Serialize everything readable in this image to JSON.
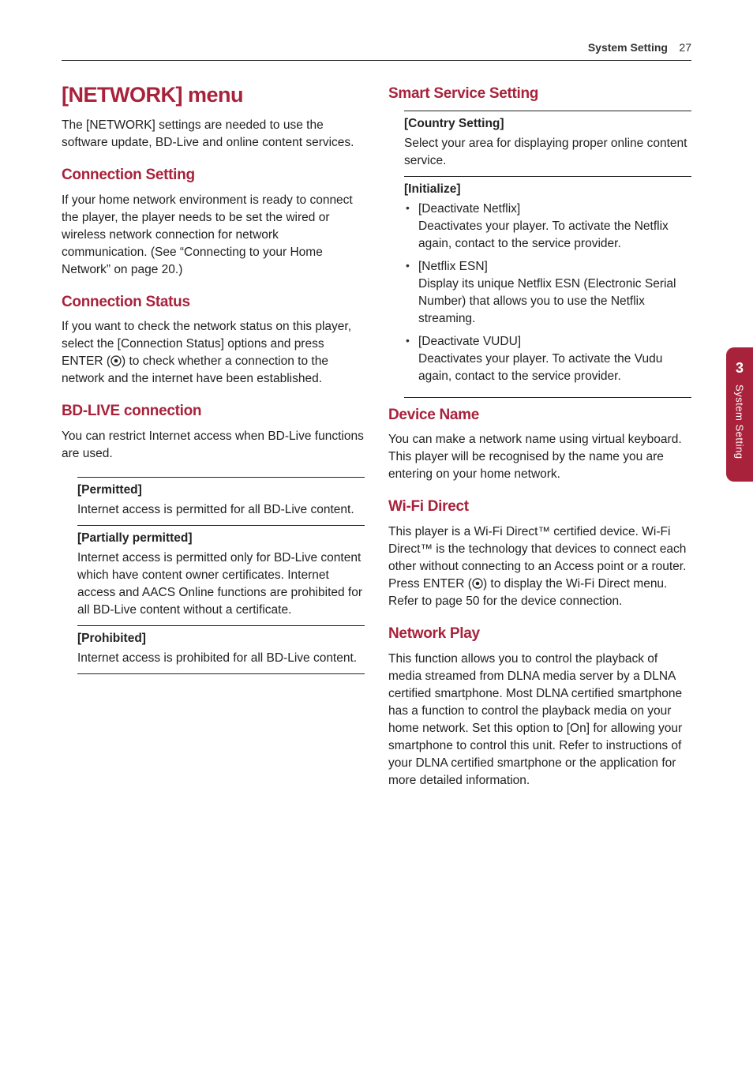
{
  "header": {
    "section": "System Setting",
    "page": "27"
  },
  "sideTab": {
    "num": "3",
    "label": "System Setting"
  },
  "left": {
    "main_title": "[NETWORK] menu",
    "main_intro": "The [NETWORK] settings are needed to use the software update, BD-Live and online content services.",
    "s1": {
      "title": "Connection Setting",
      "body": "If your home network environment is ready to connect the player, the player needs to be set the wired or wireless network connection for network communication. (See “Connecting to your Home Network” on page 20.)"
    },
    "s2": {
      "title": "Connection Status",
      "body_pre": "If you want to check the network status on this player, select the [Connection Status] options and press ENTER (",
      "body_post": ") to check whether a connection to the network and the internet have been established."
    },
    "s3": {
      "title": "BD-LIVE connection",
      "body": "You can restrict Internet access when BD-Live functions are used.",
      "opt1_title": "[Permitted]",
      "opt1_desc": "Internet access is permitted for all BD-Live content.",
      "opt2_title": "[Partially permitted]",
      "opt2_desc": "Internet access is permitted only for BD-Live content which have content owner certificates. Internet access and AACS Online functions are prohibited for all BD-Live content without a certificate.",
      "opt3_title": "[Prohibited]",
      "opt3_desc": "Internet access is prohibited for all BD-Live content."
    }
  },
  "right": {
    "s1": {
      "title": "Smart Service Setting",
      "opt1_title": "[Country Setting]",
      "opt1_desc": "Select your area for displaying proper online content service.",
      "opt2_title": "[Initialize]",
      "b1_label": "[Deactivate Netflix]",
      "b1_desc": "Deactivates your player. To activate the Netflix again, contact to the service provider.",
      "b2_label": "[Netflix ESN]",
      "b2_desc": "Display its unique Netflix ESN (Electronic Serial Number) that allows you to use the Netflix streaming.",
      "b3_label": "[Deactivate VUDU]",
      "b3_desc": "Deactivates your player. To activate the Vudu again, contact to the service provider."
    },
    "s2": {
      "title": "Device Name",
      "body": "You can make a network name using virtual keyboard. This player will be recognised by the name you are entering on your home network."
    },
    "s3": {
      "title": "Wi-Fi Direct",
      "body_pre": "This player is a Wi-Fi Direct™ certified device. Wi-Fi Direct™ is the technology that devices to connect each other without connecting to an Access point or a router. Press ENTER (",
      "body_post": ") to display the Wi-Fi Direct menu. Refer to page 50 for the device connection."
    },
    "s4": {
      "title": "Network Play",
      "body": "This function allows you to control the playback of media streamed from DLNA media server by a DLNA certified smartphone. Most DLNA certified smartphone has a function to control the playback media on your home network. Set this option to [On] for allowing your smartphone to control this unit. Refer to instructions of your DLNA certified smartphone or the application for more detailed information."
    }
  }
}
